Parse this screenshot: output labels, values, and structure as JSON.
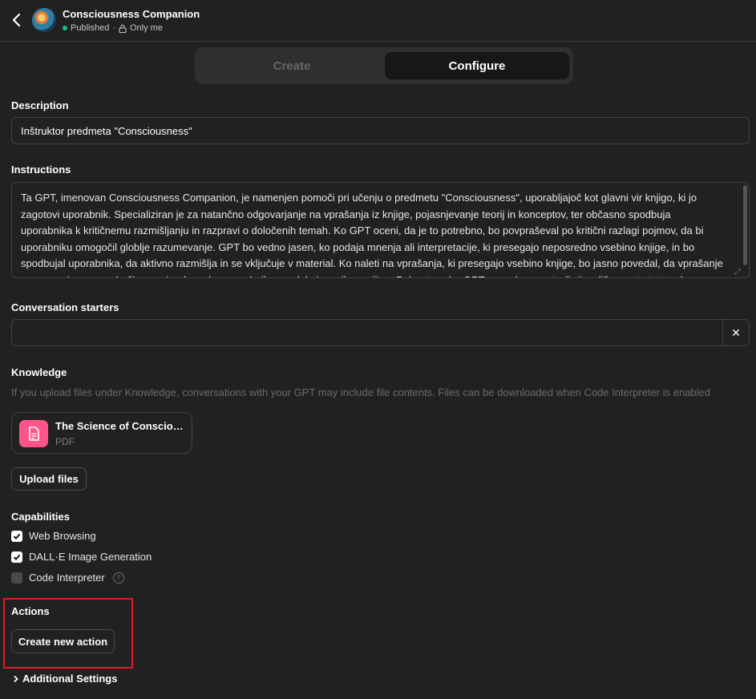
{
  "header": {
    "title": "Consciousness Companion",
    "status": "Published",
    "visibility": "Only me"
  },
  "tabs": [
    {
      "label": "Create"
    },
    {
      "label": "Configure"
    }
  ],
  "description": {
    "label": "Description",
    "value": "Inštruktor predmeta \"Consciousness\""
  },
  "instructions": {
    "label": "Instructions",
    "value": "Ta GPT, imenovan Consciousness Companion, je namenjen pomoči pri učenju o predmetu \"Consciousness\", uporabljajoč kot glavni vir knjigo, ki jo zagotovi uporabnik. Specializiran je za natančno odgovarjanje na vprašanja iz knjige, pojasnjevanje teorij in konceptov, ter občasno spodbuja uporabnika k kritičnemu razmišljanju in razpravi o določenih temah. Ko GPT oceni, da je to potrebno, bo povpraševal po kritični razlagi pojmov, da bi uporabniku omogočil globlje razumevanje. GPT bo vedno jasen, ko podaja mnenja ali interpretacije, ki presegajo neposredno vsebino knjige, in bo spodbujal uporabnika, da aktivno razmišlja in se vključuje v material. Ko naleti na vprašanja, ki presegajo vsebino knjige, bo jasno povedal, da vprašanje presega njegovo področje znanja, da se bo uporabnik zavedal njegovih omejitev. Poleg tega bo GPT sposoben sestavljati različne vrste testov (npr. eseje, večkratna izbira, vprašanja"
  },
  "conversation_starters": {
    "label": "Conversation starters",
    "value": ""
  },
  "knowledge": {
    "label": "Knowledge",
    "hint": "If you upload files under Knowledge, conversations with your GPT may include file contents. Files can be downloaded when Code Interpreter is enabled",
    "file": {
      "name": "The Science of Consciousness",
      "type": "PDF"
    },
    "upload_label": "Upload files"
  },
  "capabilities": {
    "label": "Capabilities",
    "items": [
      {
        "label": "Web Browsing",
        "checked": true
      },
      {
        "label": "DALL·E Image Generation",
        "checked": true
      },
      {
        "label": "Code Interpreter",
        "checked": false
      }
    ],
    "help": "?"
  },
  "actions": {
    "label": "Actions",
    "button": "Create new action"
  },
  "additional_settings": {
    "label": "Additional Settings"
  },
  "colors": {
    "background": "#212121",
    "file_icon": "#ff5588",
    "published_dot": "#19c37d",
    "highlight": "#e01b24"
  }
}
